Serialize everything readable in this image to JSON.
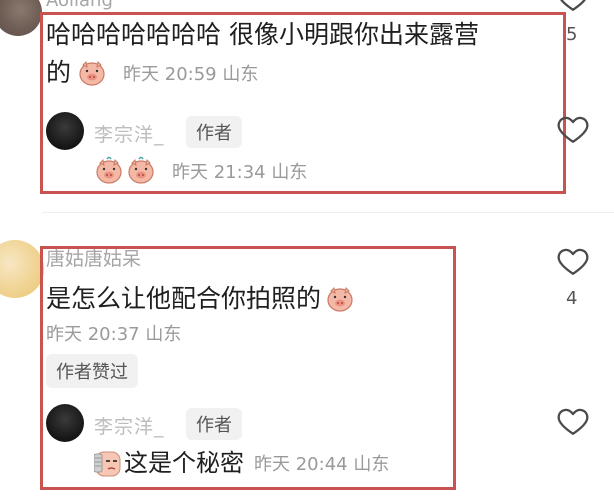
{
  "comment1": {
    "username": "Aoliang",
    "text": "哈哈哈哈哈哈哈 很像小明跟你出来露营",
    "text_line2": "的",
    "emoji": "pig-face-emoji",
    "meta": "昨天 20:59 山东",
    "like_count": "5",
    "reply": {
      "username": "李宗洋_",
      "author_tag": "作者",
      "emojis": [
        "pig-face-emoji",
        "pig-face-emoji"
      ],
      "meta": "昨天 21:34 山东"
    }
  },
  "comment2": {
    "username": "唐姑唐姑呆",
    "text": "是怎么让他配合你拍照的",
    "emoji": "pig-face-emoji",
    "meta": "昨天 20:37 山东",
    "author_liked": "作者赞过",
    "like_count": "4",
    "reply": {
      "username": "李宗洋_",
      "author_tag": "作者",
      "emoji": "secret-face-emoji",
      "text": "这是个秘密",
      "meta": "昨天 20:44 山东"
    }
  },
  "colors": {
    "highlight_box": "#c9534f",
    "meta_text": "#9a9a9a",
    "tag_bg": "#f1f1f1"
  }
}
